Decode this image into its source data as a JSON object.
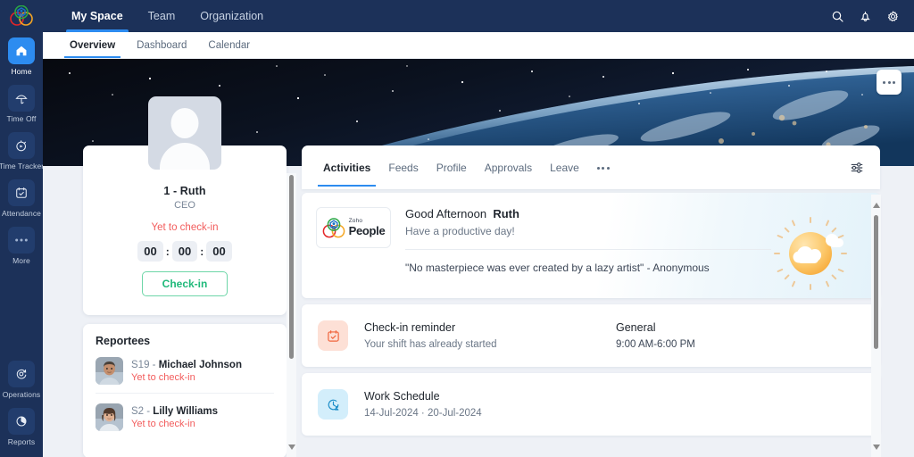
{
  "app": {
    "logo_icon": "zoho-people-logo-icon",
    "accent": "#2d8cf0",
    "header_bg": "#1c3159",
    "danger": "#f25c5c",
    "success": "#1fb97a"
  },
  "topbar": {
    "nav": [
      {
        "label": "My Space",
        "active": true
      },
      {
        "label": "Team",
        "active": false
      },
      {
        "label": "Organization",
        "active": false
      }
    ],
    "actions": [
      {
        "name": "search-icon",
        "label": "Search"
      },
      {
        "name": "bell-icon",
        "label": "Notifications"
      },
      {
        "name": "gear-icon",
        "label": "Settings"
      }
    ]
  },
  "subnav": {
    "tabs": [
      {
        "label": "Overview",
        "active": true
      },
      {
        "label": "Dashboard",
        "active": false
      },
      {
        "label": "Calendar",
        "active": false
      }
    ]
  },
  "banner": {
    "alt": "Earth from space banner",
    "more_button": "more-options"
  },
  "profile": {
    "avatar": "default-user-avatar",
    "name": "1 - Ruth",
    "role": "CEO",
    "status": "Yet to check-in",
    "timer": {
      "hours": "00",
      "minutes": "00",
      "seconds": "00",
      "separator": ":"
    },
    "checkin_label": "Check-in"
  },
  "reportees": {
    "title": "Reportees",
    "items": [
      {
        "code": "S19 - ",
        "name": "Michael Johnson",
        "status": "Yet to check-in",
        "avatar": "male-avatar"
      },
      {
        "code": "S2 - ",
        "name": "Lilly Williams",
        "status": "Yet to check-in",
        "avatar": "female-avatar"
      }
    ]
  },
  "content_tabs": {
    "tabs": [
      {
        "label": "Activities",
        "active": true
      },
      {
        "label": "Feeds",
        "active": false
      },
      {
        "label": "Profile",
        "active": false
      },
      {
        "label": "Approvals",
        "active": false
      },
      {
        "label": "Leave",
        "active": false
      }
    ],
    "overflow": "more-tabs",
    "filter_icon": "filter-sliders-icon"
  },
  "greeting": {
    "brand_small": "Zoho",
    "brand_large": "People",
    "title_prefix": "Good Afternoon",
    "title_name": "Ruth",
    "subtitle": "Have a productive day!",
    "quote": "\"No masterpiece was ever created by a lazy artist\" - Anonymous",
    "weather_icon": "partly-cloudy-sun-icon"
  },
  "activities": [
    {
      "icon": "calendar-check-icon",
      "icon_tone": "peach",
      "title": "Check-in reminder",
      "subtitle": "Your shift has already started",
      "meta_title": "General",
      "meta_sub": "9:00 AM-6:00 PM"
    },
    {
      "icon": "work-schedule-clock-icon",
      "icon_tone": "sky",
      "title": "Work Schedule",
      "subtitle": "14-Jul-2024  ·  20-Jul-2024",
      "meta_title": "",
      "meta_sub": ""
    }
  ],
  "rail": {
    "items": [
      {
        "label": "Home",
        "icon": "home-icon",
        "active": true
      },
      {
        "label": "Time Off",
        "icon": "beach-umbrella-icon",
        "active": false
      },
      {
        "label": "Time Tracker",
        "icon": "stopwatch-icon",
        "active": false
      },
      {
        "label": "Attendance",
        "icon": "calendar-check-icon",
        "active": false
      },
      {
        "label": "More",
        "icon": "ellipsis-icon",
        "active": false
      }
    ],
    "bottom_items": [
      {
        "label": "Operations",
        "icon": "operations-icon",
        "active": false
      },
      {
        "label": "Reports",
        "icon": "pie-chart-icon",
        "active": false
      }
    ]
  }
}
